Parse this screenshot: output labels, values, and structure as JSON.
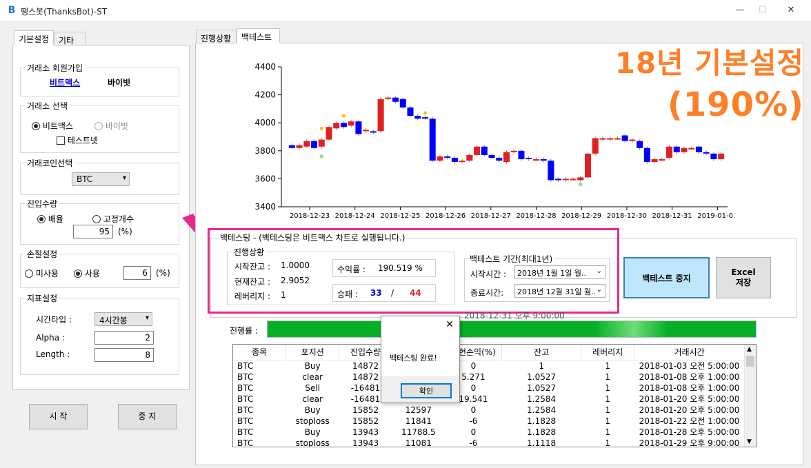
{
  "window": {
    "title": "땡스봇(ThanksBot)-ST",
    "icon_letter": "B",
    "minimize": "—",
    "maximize": "☐",
    "close": "✕"
  },
  "left_tabs": [
    "기본설정",
    "기타"
  ],
  "exchange_signup": {
    "label": "거래소 회원가입",
    "link1": "비트맥스",
    "link2": "바이빗"
  },
  "exchange_select": {
    "label": "거래소 선택",
    "opt1": "비트맥스",
    "opt2": "바이빗",
    "testnet": "테스트넷"
  },
  "coin_select": {
    "label": "거래코인선택",
    "value": "BTC"
  },
  "entry_qty": {
    "label": "진입수량",
    "opt1": "배율",
    "opt2": "고정개수",
    "value": "95",
    "unit": "(%)"
  },
  "stoploss": {
    "label": "손절설정",
    "opt1": "미사용",
    "opt2": "사용",
    "value": "6",
    "unit": "(%)"
  },
  "indicator": {
    "label": "지표설정",
    "timetype_label": "시간타입 :",
    "timetype": "4시간봉",
    "alpha_label": "Alpha :",
    "alpha": "2",
    "length_label": "Length :",
    "length": "8"
  },
  "buttons": {
    "start": "시 작",
    "stop": "중 지",
    "backtest_stop": "백테스트 중지",
    "excel_line1": "Excel",
    "excel_line2": "저장"
  },
  "right_tabs": [
    "진행상황",
    "백테스트"
  ],
  "overlay": {
    "line1": "18년 기본설정",
    "line2": "(190%)"
  },
  "backtest": {
    "title": "백테스팅 - (백테스팅은 비트맥스 차트로 실행됩니다.)",
    "status_label": "진행상황",
    "start_balance_label": "시작잔고 :",
    "start_balance": "1.0000",
    "current_balance_label": "현재잔고 :",
    "current_balance": "2.9052",
    "leverage_label": "레버리지 :",
    "leverage": "1",
    "return_label": "수익률 :",
    "return_value": "190.519 %",
    "winloss_label": "승패 :",
    "wins": "33",
    "slash": "/",
    "losses": "44",
    "period_label": "백테스트 기간(최대1년)",
    "start_time_label": "시작시간 :",
    "start_time": "2018년  1월  1일 월..",
    "end_time_label": "종료시간:",
    "end_time": "2018년 12월 31일 월..",
    "current_time": "2018-12-31 오후 9:00:00",
    "progress_label": "진행률 :",
    "progress": 1.0
  },
  "dialog": {
    "message": "백테스팅 완료!",
    "ok": "확인",
    "close": "✕"
  },
  "trade_table": {
    "columns": [
      "종목",
      "포지션",
      "진입수량",
      "",
      "실현손익(%)",
      "잔고",
      "레버리지",
      "거래시간"
    ],
    "rows": [
      [
        "BTC",
        "Buy",
        "14872",
        "",
        "0",
        "1",
        "1",
        "2018-01-03 오전 5:00:00"
      ],
      [
        "BTC",
        "clear",
        "14872",
        "",
        "5.271",
        "1.0527",
        "1",
        "2018-01-08 오후 1:00:00"
      ],
      [
        "BTC",
        "Sell",
        "-16481",
        "",
        "0",
        "1.0527",
        "1",
        "2018-01-08 오후 1:00:00"
      ],
      [
        "BTC",
        "clear",
        "-16481",
        "",
        "19.541",
        "1.2584",
        "1",
        "2018-01-20 오후 5:00:00"
      ],
      [
        "BTC",
        "Buy",
        "15852",
        "12597",
        "0",
        "1.2584",
        "1",
        "2018-01-20 오후 5:00:00"
      ],
      [
        "BTC",
        "stoploss",
        "15852",
        "11841",
        "-6",
        "1.1828",
        "1",
        "2018-01-22 오전 1:00:00"
      ],
      [
        "BTC",
        "Buy",
        "13943",
        "11788.5",
        "0",
        "1.1828",
        "1",
        "2018-01-28 오후 5:00:00"
      ],
      [
        "BTC",
        "stoploss",
        "13943",
        "11081",
        "-6",
        "1.1118",
        "1",
        "2018-01-29 오후 9:00:00"
      ]
    ]
  },
  "colors": {
    "up": "#e02020",
    "down": "#0000ff",
    "buy_marker": "#ffc000",
    "sell_marker": "#90e090",
    "highlight_box": "#e8288c",
    "overlay_text": "#ff7f27"
  },
  "chart_data": {
    "type": "candlestick",
    "ylim": [
      3400,
      4400
    ],
    "yticks": [
      3400,
      3600,
      3800,
      4000,
      4200,
      4400
    ],
    "xtick_labels": [
      "2018-12-23",
      "2018-12-24",
      "2018-12-25",
      "2018-12-26",
      "2018-12-27",
      "2018-12-28",
      "2018-12-29",
      "2018-12-30",
      "2018-12-31",
      "2019-01-01"
    ],
    "candles": [
      [
        3840,
        3820
      ],
      [
        3820,
        3840
      ],
      [
        3830,
        3870
      ],
      [
        3870,
        3820
      ],
      [
        3830,
        3880
      ],
      [
        3880,
        3970
      ],
      [
        3960,
        4000
      ],
      [
        4000,
        3970
      ],
      [
        3980,
        4010
      ],
      [
        4010,
        3920
      ],
      [
        3940,
        3950
      ],
      [
        3940,
        3930
      ],
      [
        3940,
        4170
      ],
      [
        4170,
        4180
      ],
      [
        4180,
        4150
      ],
      [
        4170,
        4110
      ],
      [
        4110,
        4050
      ],
      [
        4050,
        4030
      ],
      [
        4040,
        4030
      ],
      [
        4030,
        3730
      ],
      [
        3730,
        3760
      ],
      [
        3760,
        3750
      ],
      [
        3750,
        3720
      ],
      [
        3720,
        3730
      ],
      [
        3730,
        3770
      ],
      [
        3770,
        3830
      ],
      [
        3830,
        3770
      ],
      [
        3770,
        3750
      ],
      [
        3750,
        3730
      ],
      [
        3720,
        3790
      ],
      [
        3790,
        3800
      ],
      [
        3800,
        3740
      ],
      [
        3750,
        3740
      ],
      [
        3740,
        3740
      ],
      [
        3740,
        3730
      ],
      [
        3730,
        3590
      ],
      [
        3600,
        3590
      ],
      [
        3590,
        3600
      ],
      [
        3600,
        3600
      ],
      [
        3590,
        3610
      ],
      [
        3610,
        3780
      ],
      [
        3780,
        3890
      ],
      [
        3880,
        3890
      ],
      [
        3880,
        3890
      ],
      [
        3890,
        3890
      ],
      [
        3910,
        3870
      ],
      [
        3870,
        3880
      ],
      [
        3870,
        3820
      ],
      [
        3820,
        3720
      ],
      [
        3720,
        3740
      ],
      [
        3740,
        3740
      ],
      [
        3750,
        3830
      ],
      [
        3830,
        3790
      ],
      [
        3790,
        3820
      ],
      [
        3820,
        3820
      ],
      [
        3830,
        3790
      ],
      [
        3790,
        3780
      ],
      [
        3780,
        3740
      ],
      [
        3740,
        3780
      ]
    ],
    "markers": [
      {
        "index": 4,
        "kind": "buy",
        "price": 3960
      },
      {
        "index": 4,
        "kind": "sell",
        "price": 3760
      },
      {
        "index": 7,
        "kind": "buy",
        "price": 4050
      },
      {
        "index": 18,
        "kind": "buy",
        "price": 4070
      },
      {
        "index": 39,
        "kind": "sell",
        "price": 3560
      }
    ]
  }
}
